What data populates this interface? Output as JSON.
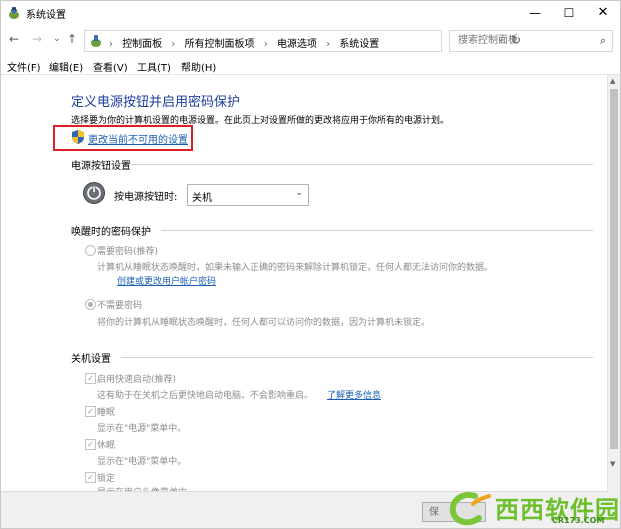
{
  "window": {
    "title": "系统设置",
    "controls": {
      "minimize": "—",
      "maximize": "☐",
      "close": "✕"
    }
  },
  "nav": {
    "back": "←",
    "forward": "→",
    "dropdown": "⌄",
    "up": "↑"
  },
  "address": {
    "crumbs": [
      "控制面板",
      "所有控制面板项",
      "电源选项",
      "系统设置"
    ],
    "separator": "›",
    "dropdown": "⌄",
    "refresh": "↻"
  },
  "search": {
    "placeholder": "搜索控制面板",
    "icon": "⌕"
  },
  "menu": [
    "文件(F)",
    "编辑(E)",
    "查看(V)",
    "工具(T)",
    "帮助(H)"
  ],
  "page": {
    "title": "定义电源按钮并启用密码保护",
    "description": "选择要为你的计算机设置的电源设置。在此页上对设置所做的更改将应用于你所有的电源计划。",
    "change_link": "更改当前不可用的设置"
  },
  "power_buttons": {
    "heading": "电源按钮设置",
    "label": "按电源按钮时:",
    "value": "关机"
  },
  "wake_password": {
    "heading": "唤醒时的密码保护",
    "opt1_label": "需要密码(推荐)",
    "opt1_desc": "计算机从睡眠状态唤醒时，如果未输入正确的密码来解除计算机锁定，任何人都无法访问你的数据。",
    "opt1_link": "创建或更改用户帐户密码",
    "opt2_label": "不需要密码",
    "opt2_desc": "将你的计算机从睡眠状态唤醒时，任何人都可以访问你的数据，因为计算机未锁定。",
    "selected": "不需要密码"
  },
  "shutdown": {
    "heading": "关机设置",
    "fast_label": "启用快速启动(推荐)",
    "fast_desc": "这有助于在关机之后更快地启动电脑。不会影响重启。",
    "fast_link": "了解更多信息",
    "sleep_label": "睡眠",
    "sleep_desc": "显示在\"电源\"菜单中。",
    "hibernate_label": "休眠",
    "hibernate_desc": "显示在\"电源\"菜单中。",
    "lock_label": "锁定",
    "lock_desc": "显示在用户头像菜单中。",
    "checked_mark": "✓"
  },
  "footer": {
    "save_label": "保"
  },
  "watermark": {
    "brand": "西西软件园",
    "domain": "CR173.COM"
  }
}
